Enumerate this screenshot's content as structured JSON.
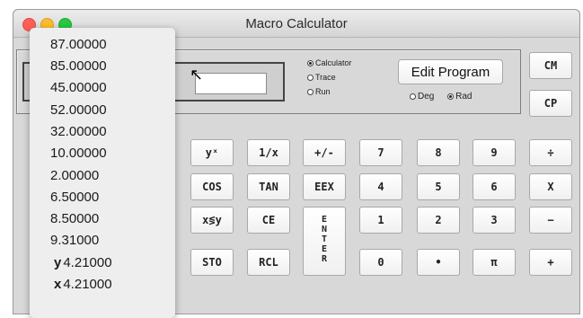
{
  "window": {
    "title": "Macro Calculator"
  },
  "mode": {
    "options": [
      {
        "label": "Calculator",
        "selected": true
      },
      {
        "label": "Trace",
        "selected": false
      },
      {
        "label": "Run",
        "selected": false
      }
    ]
  },
  "edit_program_label": "Edit Program",
  "angle": {
    "options": [
      {
        "label": "Deg",
        "selected": false
      },
      {
        "label": "Rad",
        "selected": true
      }
    ]
  },
  "side_buttons": {
    "cm": "CM",
    "cp": "CP"
  },
  "keys": {
    "row1": [
      "yˣ",
      "1/x",
      "+/-",
      "7",
      "8",
      "9",
      "÷"
    ],
    "row2": [
      "COS",
      "TAN",
      "EEX",
      "4",
      "5",
      "6",
      "X"
    ],
    "row3": [
      "x≶y",
      "CE",
      "1",
      "2",
      "3",
      "−"
    ],
    "row4": [
      "STO",
      "RCL",
      "0",
      "•",
      "π",
      "+"
    ],
    "enter": "ENTER"
  },
  "stack_popup": {
    "values": [
      "87.00000",
      "85.00000",
      "45.00000",
      "52.00000",
      "32.00000",
      "10.00000",
      "2.00000",
      "6.50000",
      "8.50000",
      "9.31000"
    ],
    "y_label": "y",
    "y_value": "4.21000",
    "x_label": "x",
    "x_value": "4.21000"
  },
  "colors": {
    "window_bg": "#d8d8d8",
    "popup_bg": "#eeeeee",
    "key_bg": "#ffffff"
  }
}
